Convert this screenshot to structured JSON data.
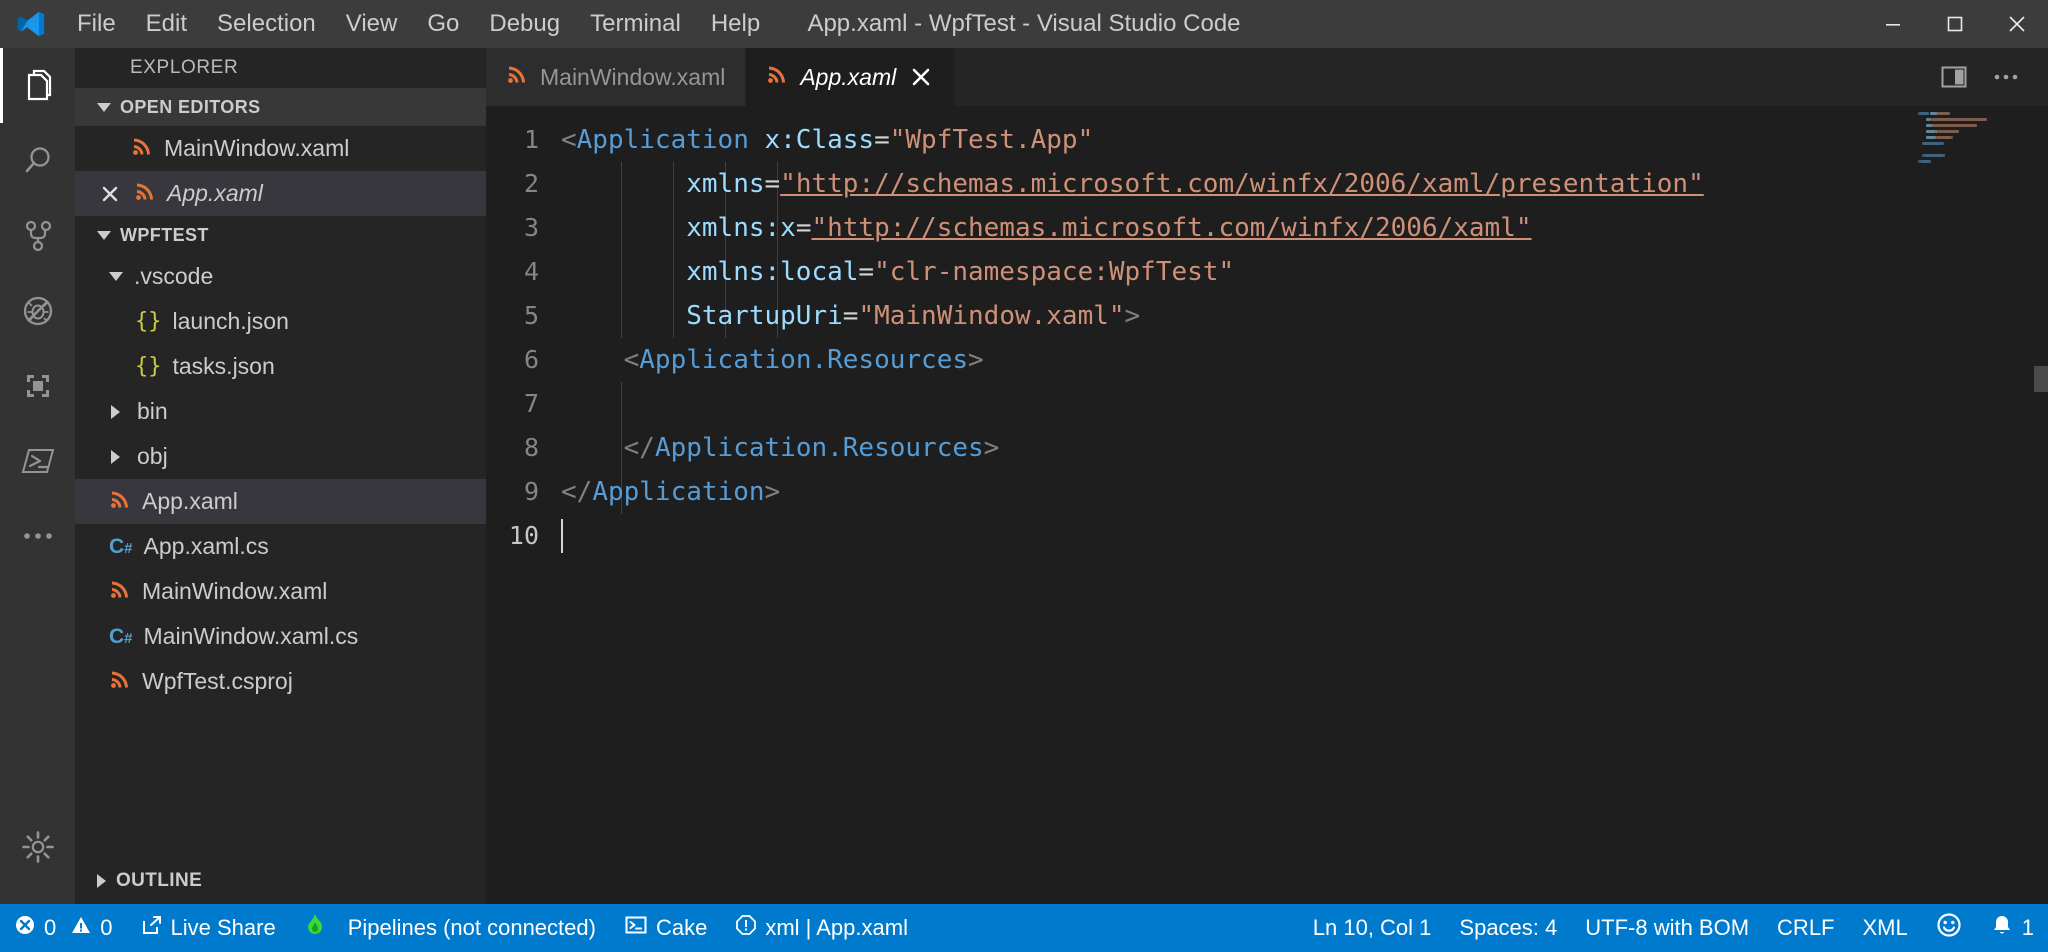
{
  "window": {
    "title": "App.xaml - WpfTest - Visual Studio Code",
    "logo_icon": "vscode-logo-icon",
    "minimize_icon": "minimize-icon",
    "maximize_icon": "maximize-icon",
    "close_icon": "close-icon"
  },
  "menubar": {
    "items": [
      {
        "label": "File"
      },
      {
        "label": "Edit"
      },
      {
        "label": "Selection"
      },
      {
        "label": "View"
      },
      {
        "label": "Go"
      },
      {
        "label": "Debug"
      },
      {
        "label": "Terminal"
      },
      {
        "label": "Help"
      }
    ]
  },
  "activitybar": {
    "items": [
      {
        "name": "explorer-icon",
        "active": true
      },
      {
        "name": "search-icon",
        "active": false
      },
      {
        "name": "source-control-icon",
        "active": false
      },
      {
        "name": "run-debug-icon",
        "active": false
      },
      {
        "name": "extensions-icon",
        "active": false
      },
      {
        "name": "powershell-icon",
        "active": false
      }
    ],
    "more_icon": "more-actions-icon",
    "settings_icon": "gear-icon"
  },
  "sidebar": {
    "title": "EXPLORER",
    "open_editors": {
      "label": "OPEN EDITORS",
      "expanded": true,
      "items": [
        {
          "label": "MainWindow.xaml",
          "icon": "xaml-file-icon",
          "italic": false,
          "dirty": false,
          "selected": false,
          "show_close": false
        },
        {
          "label": "App.xaml",
          "icon": "xaml-file-icon",
          "italic": true,
          "dirty": false,
          "selected": true,
          "show_close": true
        }
      ]
    },
    "workspace": {
      "label": "WPFTEST",
      "expanded": true,
      "items": [
        {
          "label": ".vscode",
          "icon": "folder-open-icon",
          "kind": "folder",
          "depth": 1,
          "expanded": true,
          "selected": false
        },
        {
          "label": "launch.json",
          "icon": "json-file-icon",
          "kind": "file",
          "depth": 2,
          "selected": false
        },
        {
          "label": "tasks.json",
          "icon": "json-file-icon",
          "kind": "file",
          "depth": 2,
          "selected": false
        },
        {
          "label": "bin",
          "icon": "folder-icon",
          "kind": "folder",
          "depth": 1,
          "expanded": false,
          "selected": false
        },
        {
          "label": "obj",
          "icon": "folder-icon",
          "kind": "folder",
          "depth": 1,
          "expanded": false,
          "selected": false
        },
        {
          "label": "App.xaml",
          "icon": "xaml-file-icon",
          "kind": "file",
          "depth": 1,
          "selected": true
        },
        {
          "label": "App.xaml.cs",
          "icon": "csharp-file-icon",
          "kind": "file",
          "depth": 1,
          "selected": false
        },
        {
          "label": "MainWindow.xaml",
          "icon": "xaml-file-icon",
          "kind": "file",
          "depth": 1,
          "selected": false
        },
        {
          "label": "MainWindow.xaml.cs",
          "icon": "csharp-file-icon",
          "kind": "file",
          "depth": 1,
          "selected": false
        },
        {
          "label": "WpfTest.csproj",
          "icon": "xaml-file-icon",
          "kind": "file",
          "depth": 1,
          "selected": false
        }
      ]
    },
    "outline": {
      "label": "OUTLINE",
      "expanded": false
    }
  },
  "editor": {
    "tabs": [
      {
        "label": "MainWindow.xaml",
        "icon": "xaml-file-icon",
        "active": false,
        "italic": false,
        "show_close": false
      },
      {
        "label": "App.xaml",
        "icon": "xaml-file-icon",
        "active": true,
        "italic": true,
        "show_close": true
      }
    ],
    "actions": [
      {
        "name": "split-editor-icon"
      },
      {
        "name": "more-actions-icon"
      }
    ],
    "line_numbers": [
      "1",
      "2",
      "3",
      "4",
      "5",
      "6",
      "7",
      "8",
      "9",
      "10"
    ],
    "current_line": 10,
    "lines": [
      {
        "n": 1,
        "tokens": [
          {
            "t": "<",
            "c": "brk"
          },
          {
            "t": "Application",
            "c": "tagb"
          },
          {
            "t": " ",
            "c": "eq"
          },
          {
            "t": "x:Class",
            "c": "attr"
          },
          {
            "t": "=",
            "c": "eq"
          },
          {
            "t": "\"WpfTest.App\"",
            "c": "str"
          }
        ]
      },
      {
        "n": 2,
        "tokens": [
          {
            "t": "        ",
            "c": "eq"
          },
          {
            "t": "xmlns",
            "c": "attr"
          },
          {
            "t": "=",
            "c": "eq"
          },
          {
            "t": "\"http://schemas.microsoft.com/winfx/2006/xaml/presentation\"",
            "c": "str link"
          }
        ]
      },
      {
        "n": 3,
        "tokens": [
          {
            "t": "        ",
            "c": "eq"
          },
          {
            "t": "xmlns:x",
            "c": "attr"
          },
          {
            "t": "=",
            "c": "eq"
          },
          {
            "t": "\"http://schemas.microsoft.com/winfx/2006/xaml\"",
            "c": "str link"
          }
        ]
      },
      {
        "n": 4,
        "tokens": [
          {
            "t": "        ",
            "c": "eq"
          },
          {
            "t": "xmlns:local",
            "c": "attr"
          },
          {
            "t": "=",
            "c": "eq"
          },
          {
            "t": "\"clr-namespace:WpfTest\"",
            "c": "str"
          }
        ]
      },
      {
        "n": 5,
        "tokens": [
          {
            "t": "        ",
            "c": "eq"
          },
          {
            "t": "StartupUri",
            "c": "attr"
          },
          {
            "t": "=",
            "c": "eq"
          },
          {
            "t": "\"MainWindow.xaml\"",
            "c": "str"
          },
          {
            "t": ">",
            "c": "brk"
          }
        ]
      },
      {
        "n": 6,
        "tokens": [
          {
            "t": "    ",
            "c": "eq"
          },
          {
            "t": "<",
            "c": "brk"
          },
          {
            "t": "Application.Resources",
            "c": "tagb"
          },
          {
            "t": ">",
            "c": "brk"
          }
        ]
      },
      {
        "n": 7,
        "tokens": []
      },
      {
        "n": 8,
        "tokens": [
          {
            "t": "    ",
            "c": "eq"
          },
          {
            "t": "</",
            "c": "brk"
          },
          {
            "t": "Application.Resources",
            "c": "tagb"
          },
          {
            "t": ">",
            "c": "brk"
          }
        ]
      },
      {
        "n": 9,
        "tokens": [
          {
            "t": "</",
            "c": "brk"
          },
          {
            "t": "Application",
            "c": "tagb"
          },
          {
            "t": ">",
            "c": "brk"
          }
        ]
      },
      {
        "n": 10,
        "tokens": []
      }
    ]
  },
  "statusbar": {
    "left": [
      {
        "name": "errors-item",
        "icon": "error-icon",
        "label": "0"
      },
      {
        "name": "warnings-item",
        "icon": "warning-icon",
        "label": "0"
      },
      {
        "name": "live-share",
        "icon": "live-share-icon",
        "label": "Live Share"
      },
      {
        "name": "pipelines",
        "icon": "flame-icon",
        "label": "Pipelines (not connected)"
      },
      {
        "name": "cake",
        "icon": "terminal-icon",
        "label": "Cake"
      },
      {
        "name": "xml-problems",
        "icon": "alert-circle-icon",
        "label": "xml | App.xaml",
        "secondary_icon": "file-check-icon"
      }
    ],
    "right": [
      {
        "name": "cursor-position",
        "label": "Ln 10, Col 1"
      },
      {
        "name": "indentation",
        "label": "Spaces: 4"
      },
      {
        "name": "encoding",
        "label": "UTF-8 with BOM"
      },
      {
        "name": "eol",
        "label": "CRLF"
      },
      {
        "name": "language-mode",
        "label": "XML"
      },
      {
        "name": "feedback",
        "icon": "smiley-icon",
        "label": ""
      },
      {
        "name": "notifications",
        "icon": "bell-icon",
        "label": "1"
      }
    ]
  },
  "colors": {
    "accent": "#007acc",
    "titlebar": "#3c3c3c",
    "sidebar": "#252526",
    "editor": "#1e1e1e",
    "xaml_icon": "#e8733a",
    "json_icon": "#cbcb41",
    "csharp_icon": "#4f9fcf",
    "tag": "#569cd6",
    "attribute": "#9cdcfe",
    "string": "#ce9178"
  }
}
